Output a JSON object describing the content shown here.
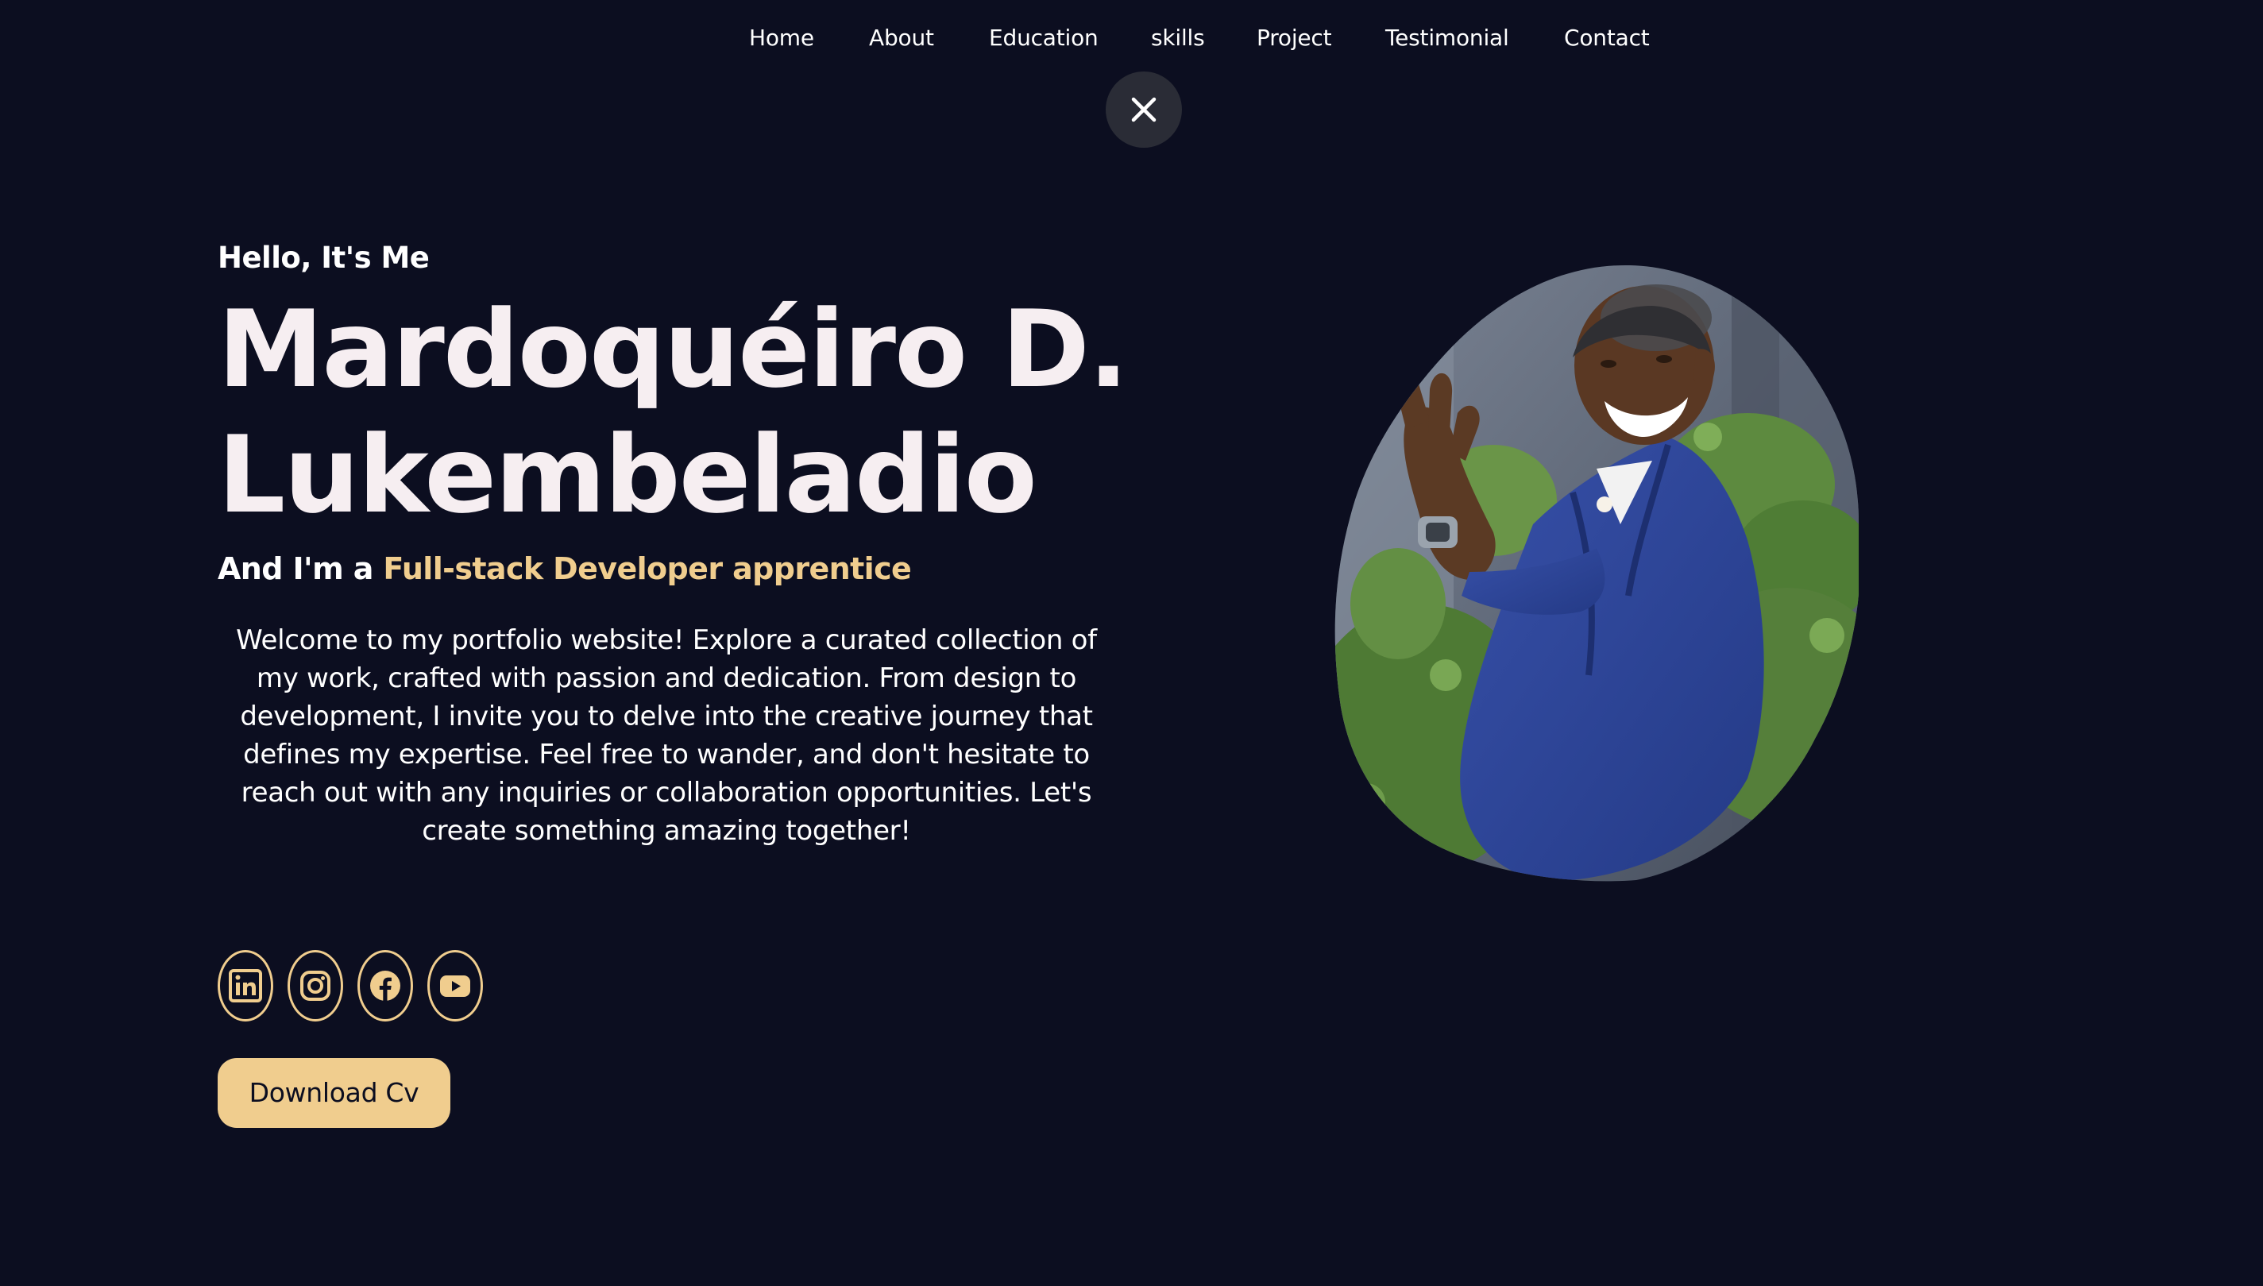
{
  "nav": {
    "items": [
      {
        "label": "Home"
      },
      {
        "label": "About"
      },
      {
        "label": "Education"
      },
      {
        "label": "skills"
      },
      {
        "label": "Project"
      },
      {
        "label": "Testimonial"
      },
      {
        "label": "Contact"
      }
    ]
  },
  "close_button": {
    "icon": "close-icon"
  },
  "hero": {
    "greeting": "Hello, It's Me",
    "name_line1": "Mardoquéiro D.",
    "name_line2": "Lukembeladio",
    "role_prefix": "And I'm a",
    "role_highlight": "Full-stack Developer apprentice",
    "intro": "Welcome to my portfolio website! Explore a curated collection of my work, crafted with passion and dedication. From design to development, I invite you to delve into the creative journey that defines my expertise. Feel free to wander, and don't hesitate to reach out with any inquiries or collaboration opportunities. Let's create something amazing together!",
    "download_label": "Download Cv"
  },
  "socials": [
    {
      "icon": "linkedin-icon"
    },
    {
      "icon": "instagram-icon"
    },
    {
      "icon": "facebook-icon"
    },
    {
      "icon": "youtube-icon"
    }
  ],
  "portrait": {
    "icon": "profile-photo"
  },
  "colors": {
    "background": "#0c0e20",
    "accent": "#f0cd8e",
    "text": "#ffffff",
    "close_button_bg": "#2a2c36"
  }
}
